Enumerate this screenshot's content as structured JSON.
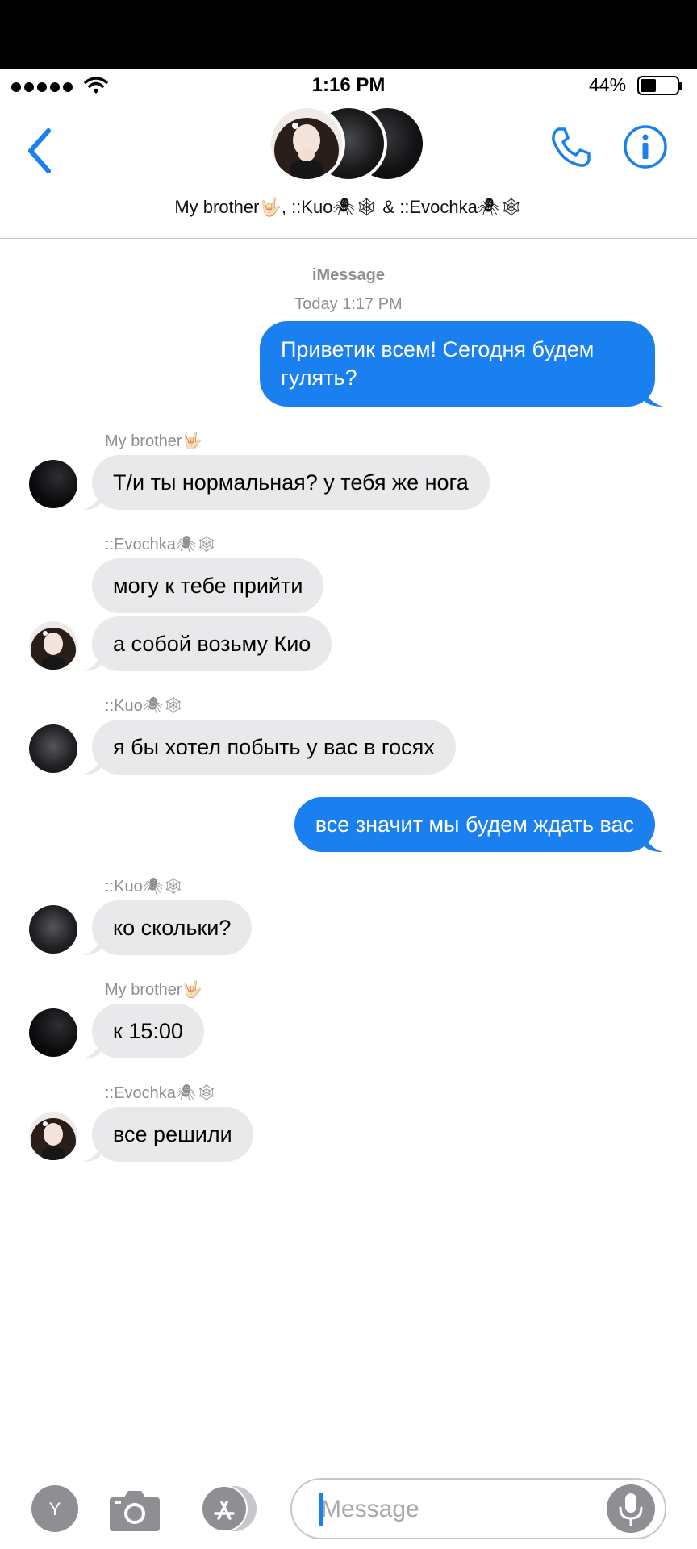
{
  "status_bar": {
    "time": "1:16 PM",
    "battery": "44%",
    "battery_level": 0.44
  },
  "header": {
    "group_name": "My brother🤟🏻, ::Kuo🕷🕸 & ::Evochka🕷🕸",
    "back_icon": "chevron-left-icon",
    "call_icon": "phone-icon",
    "info_icon": "info-icon"
  },
  "thread": {
    "service": "iMessage",
    "timestamp": "Today 1:17 PM"
  },
  "messages": [
    {
      "direction": "out",
      "text": "Приветик всем! Сегодня будем гулять?"
    },
    {
      "direction": "in",
      "sender": "My brother🤟🏻",
      "text": "Т/и ты нормальная?  у тебя же нога"
    },
    {
      "direction": "in",
      "sender": "::Evochka🕷🕸",
      "text": "могу к тебе прийти"
    },
    {
      "direction": "in",
      "text": "а собой возьму Кио"
    },
    {
      "direction": "in",
      "sender": "::Kuo🕷🕸",
      "text": "я бы хотел побыть у вас в госях"
    },
    {
      "direction": "out",
      "text": "все значит мы будем ждать вас"
    },
    {
      "direction": "in",
      "sender": "::Kuo🕷🕸",
      "text": "ко скольки?"
    },
    {
      "direction": "in",
      "sender": "My brother🤟🏻",
      "text": "к 15:00"
    },
    {
      "direction": "in",
      "sender": "::Evochka🕷🕸",
      "text": "все решили"
    }
  ],
  "compose": {
    "placeholder": "Message",
    "apps_button_label": "Y",
    "camera_icon": "camera-icon",
    "appstore_icon": "app-store-icon",
    "mic_icon": "microphone-icon"
  },
  "colors": {
    "accent": "#1a80f0",
    "incoming_bubble": "#e9e9eb",
    "meta_text": "#8e8e93"
  }
}
